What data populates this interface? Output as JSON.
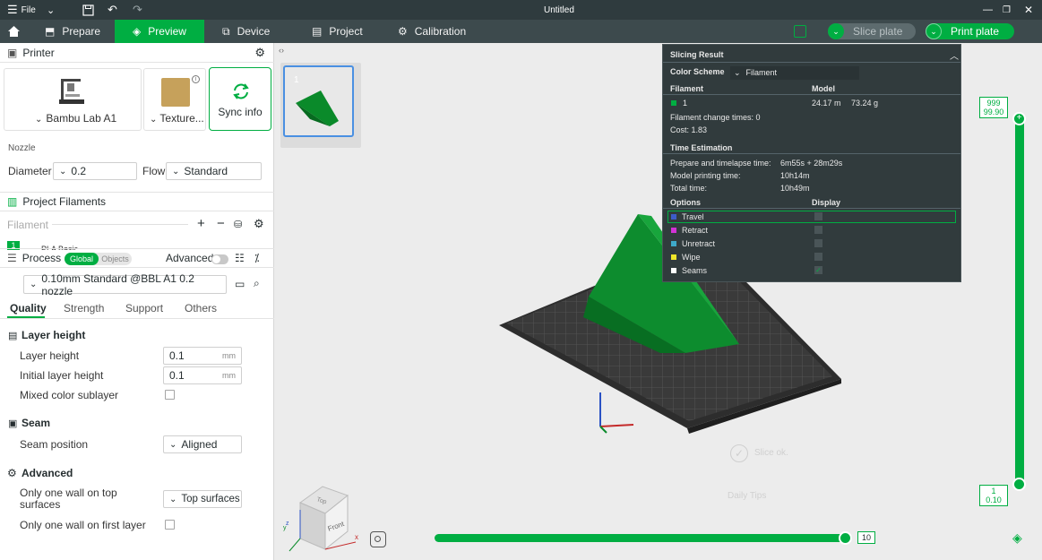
{
  "titlebar": {
    "file": "File",
    "title": "Untitled"
  },
  "nav": {
    "tabs": [
      "Prepare",
      "Preview",
      "Device",
      "Project",
      "Calibration"
    ],
    "slice": "Slice plate",
    "print": "Print plate"
  },
  "printer": {
    "title": "Printer",
    "model": "Bambu Lab A1",
    "plate": "Texture...",
    "sync": "Sync info",
    "nozzle_label": "Nozzle",
    "diameter_label": "Diameter",
    "diameter": "0.2",
    "flow_label": "Flow",
    "flow": "Standard"
  },
  "filaments": {
    "title": "Project Filaments",
    "header": "Filament",
    "row_num": "1",
    "row_name": "PLA Basic"
  },
  "process": {
    "title": "Process",
    "global": "Global",
    "objects": "Objects",
    "advanced": "Advanced",
    "preset": "0.10mm Standard @BBL A1 0.2 nozzle",
    "tabs": [
      "Quality",
      "Strength",
      "Support",
      "Others"
    ]
  },
  "settings": {
    "layer_height_head": "Layer height",
    "layer_height": "Layer height",
    "layer_height_val": "0.1",
    "initial_layer": "Initial layer height",
    "initial_layer_val": "0.1",
    "unit": "mm",
    "mixed": "Mixed color sublayer",
    "seam_head": "Seam",
    "seam_pos": "Seam position",
    "seam_val": "Aligned",
    "adv_head": "Advanced",
    "one_wall_top": "Only one wall on top surfaces",
    "one_wall_top_val": "Top surfaces",
    "one_wall_first": "Only one wall on first layer"
  },
  "plate_thumb": {
    "num": "1"
  },
  "result": {
    "title": "Slicing Result",
    "scheme_label": "Color Scheme",
    "scheme": "Filament",
    "col_filament": "Filament",
    "col_model": "Model",
    "f_num": "1",
    "f_len": "24.17 m",
    "f_weight": "73.24 g",
    "change_times": "Filament change times:  0",
    "cost": "Cost:  1.83",
    "time_head": "Time Estimation",
    "prep_label": "Prepare and timelapse time:",
    "prep_val": "6m55s + 28m29s",
    "model_label": "Model printing time:",
    "model_val": "10h14m",
    "total_label": "Total time:",
    "total_val": "10h49m",
    "opt_head": "Options",
    "disp_head": "Display",
    "options": [
      "Travel",
      "Retract",
      "Unretract",
      "Wipe",
      "Seams"
    ],
    "colors": {
      "accent": "#00ae42",
      "travel": "#3d5cc8",
      "retract": "#d233d6",
      "unretract": "#3ea9c9",
      "wipe": "#f0e62a",
      "seams": "#ffffff"
    }
  },
  "slider": {
    "top1": "999",
    "top2": "99.90",
    "bot1": "1",
    "bot2": "0.10",
    "h_val": "10"
  },
  "viewport": {
    "slice_ok": "Slice ok.",
    "daily_tips": "Daily Tips"
  },
  "cube": {
    "front": "Front",
    "top": "Top"
  }
}
